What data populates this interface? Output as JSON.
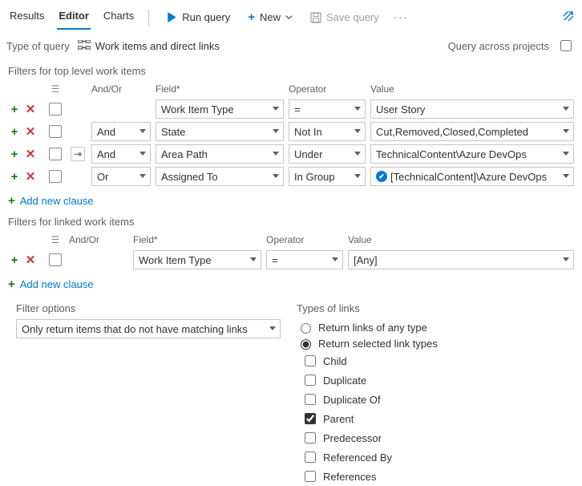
{
  "tabs": {
    "results": "Results",
    "editor": "Editor",
    "charts": "Charts"
  },
  "toolbar": {
    "run": "Run query",
    "new": "New",
    "save": "Save query"
  },
  "qtype": {
    "label": "Type of query",
    "value": "Work items and direct links"
  },
  "across": "Query across projects",
  "topTitle": "Filters for top level work items",
  "cols": {
    "andor": "And/Or",
    "field": "Field*",
    "op": "Operator",
    "val": "Value"
  },
  "top": [
    {
      "andor": "",
      "field": "Work Item Type",
      "op": "=",
      "val": "User Story",
      "grp": false
    },
    {
      "andor": "And",
      "field": "State",
      "op": "Not In",
      "val": "Cut,Removed,Closed,Completed",
      "grp": false
    },
    {
      "andor": "And",
      "field": "Area Path",
      "op": "Under",
      "val": "TechnicalContent\\Azure DevOps",
      "grp": true
    },
    {
      "andor": "Or",
      "field": "Assigned To",
      "op": "In Group",
      "val": "[TechnicalContent]\\Azure DevOps",
      "grp": false,
      "vsIcon": true
    }
  ],
  "addClause": "Add new clause",
  "linkedTitle": "Filters for linked work items",
  "linked": [
    {
      "andor": "",
      "field": "Work Item Type",
      "op": "=",
      "val": "[Any]"
    }
  ],
  "filterOptions": {
    "title": "Filter options",
    "value": "Only return items that do not have matching links"
  },
  "linkTypes": {
    "title": "Types of links",
    "any": "Return links of any type",
    "selected": "Return selected link types",
    "types": [
      {
        "label": "Child",
        "checked": false
      },
      {
        "label": "Duplicate",
        "checked": false
      },
      {
        "label": "Duplicate Of",
        "checked": false
      },
      {
        "label": "Parent",
        "checked": true
      },
      {
        "label": "Predecessor",
        "checked": false
      },
      {
        "label": "Referenced By",
        "checked": false
      },
      {
        "label": "References",
        "checked": false
      }
    ]
  }
}
